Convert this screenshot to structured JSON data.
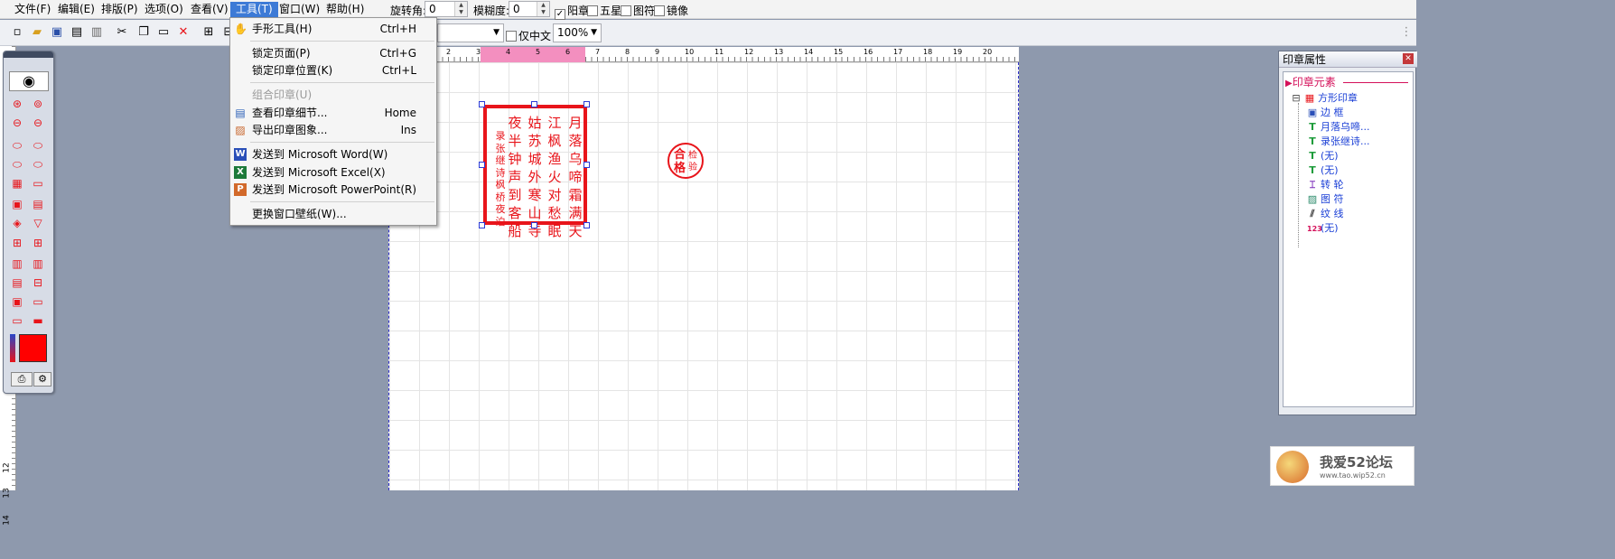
{
  "menubar": {
    "items": [
      "文件(F)",
      "编辑(E)",
      "排版(P)",
      "选项(O)",
      "查看(V)",
      "工具(T)",
      "窗口(W)",
      "帮助(H)"
    ],
    "rotation_label": "旋转角:",
    "rotation_value": "0",
    "blur_label": "模糊度:",
    "blur_value": "0",
    "check_yang": "阳章",
    "check_star": "五星",
    "check_symbol": "图符",
    "check_mirror": "镜像"
  },
  "toolbar": {
    "font_combo_value": "",
    "chinese_only_label": "仅中文",
    "zoom_value": "100%"
  },
  "tools_menu": {
    "items": [
      {
        "label": "手形工具(H)",
        "shortcut": "Ctrl+H",
        "icon": "hand-icon",
        "disabled": false
      },
      {
        "label": "锁定页面(P)",
        "shortcut": "Ctrl+G",
        "icon": "",
        "disabled": false
      },
      {
        "label": "锁定印章位置(K)",
        "shortcut": "Ctrl+L",
        "icon": "",
        "disabled": false
      },
      {
        "label": "组合印章(U)",
        "shortcut": "",
        "icon": "",
        "disabled": true
      },
      {
        "label": "查看印章细节...",
        "shortcut": "Home",
        "icon": "view-detail-icon",
        "disabled": false
      },
      {
        "label": "导出印章图象...",
        "shortcut": "Ins",
        "icon": "export-image-icon",
        "disabled": false
      },
      {
        "label": "发送到 Microsoft Word(W)",
        "shortcut": "",
        "icon": "word-icon",
        "disabled": false
      },
      {
        "label": "发送到 Microsoft Excel(X)",
        "shortcut": "",
        "icon": "excel-icon",
        "disabled": false
      },
      {
        "label": "发送到 Microsoft PowerPoint(R)",
        "shortcut": "",
        "icon": "powerpoint-icon",
        "disabled": false
      },
      {
        "label": "更换窗口壁纸(W)...",
        "shortcut": "",
        "icon": "",
        "disabled": false
      }
    ]
  },
  "ruler": {
    "h_numbers": [
      "2",
      "3",
      "4",
      "5",
      "6",
      "7",
      "8",
      "9",
      "10",
      "11",
      "12",
      "13",
      "14",
      "15",
      "16",
      "17",
      "18",
      "19",
      "20"
    ],
    "v_numbers": [
      "12",
      "13",
      "14"
    ]
  },
  "seal": {
    "columns": [
      "月落乌啼霜满天",
      "江枫渔火对愁眠",
      "姑苏城外寒山寺",
      "夜半钟声到客船"
    ],
    "small_column_1": "录张继诗",
    "small_column_2": "枫桥夜泊",
    "color": "#e8141a"
  },
  "mini_seal": {
    "big": "合格",
    "small": "检验"
  },
  "panel": {
    "title": "印章属性",
    "section": "印章元素",
    "tree": [
      {
        "label": "方形印章",
        "icon": "grid-icon"
      },
      {
        "label": "边 框",
        "icon": "border-icon"
      },
      {
        "label": "月落乌啼...",
        "icon": "text-icon"
      },
      {
        "label": "录张继诗...",
        "icon": "text-icon"
      },
      {
        "label": "(无)",
        "icon": "text-icon"
      },
      {
        "label": "(无)",
        "icon": "text-plus-icon"
      },
      {
        "label": "转 轮",
        "icon": "wheel-icon"
      },
      {
        "label": "图 符",
        "icon": "image-icon"
      },
      {
        "label": "纹 线",
        "icon": "hatch-icon"
      },
      {
        "label": "(无)",
        "icon": "number-icon"
      }
    ]
  },
  "watermark": {
    "text": "我爱52论坛",
    "url": "www.tao.wip52.cn"
  }
}
